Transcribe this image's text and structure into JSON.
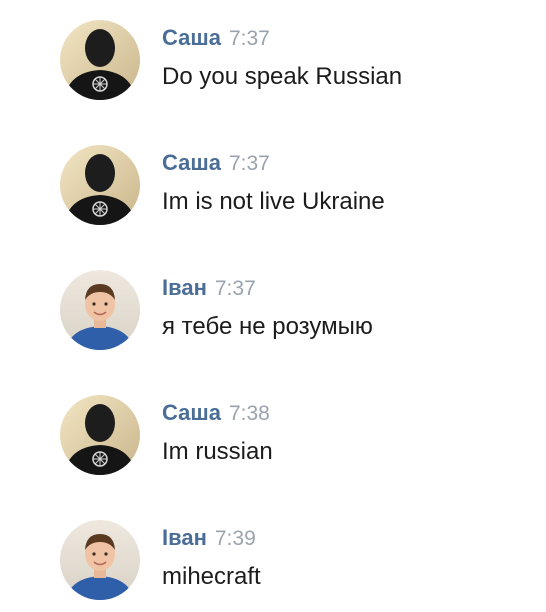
{
  "colors": {
    "sender_name": "#4a6e96",
    "timestamp": "#9aa3ad",
    "message_text": "#1c1c1c",
    "background": "#ffffff"
  },
  "messages": [
    {
      "sender": "Саша",
      "time": "7:37",
      "text": "Do you speak Russian",
      "avatar": "masked-person-avatar"
    },
    {
      "sender": "Саша",
      "time": "7:37",
      "text": "Im is not live Ukraine",
      "avatar": "masked-person-avatar"
    },
    {
      "sender": "Іван",
      "time": "7:37",
      "text": "я тебе не розумыю",
      "avatar": "boy-photo-avatar"
    },
    {
      "sender": "Саша",
      "time": "7:38",
      "text": "Im russian",
      "avatar": "masked-person-avatar"
    },
    {
      "sender": "Іван",
      "time": "7:39",
      "text": "mihecraft",
      "avatar": "boy-photo-avatar"
    }
  ]
}
